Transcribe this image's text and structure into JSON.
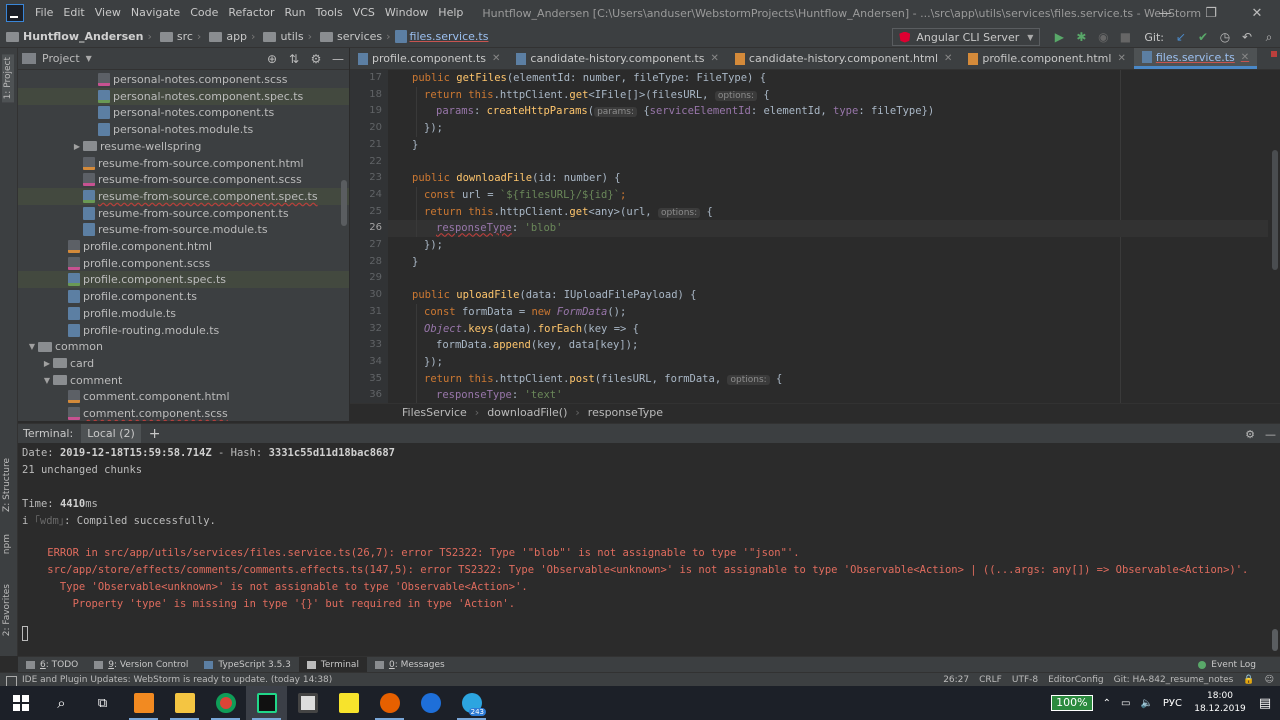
{
  "menubar": {
    "items": [
      "File",
      "Edit",
      "View",
      "Navigate",
      "Code",
      "Refactor",
      "Run",
      "Tools",
      "VCS",
      "Window",
      "Help"
    ],
    "title": "Huntflow_Andersen [C:\\Users\\anduser\\WebstormProjects\\Huntflow_Andersen] - ...\\src\\app\\utils\\services\\files.service.ts - WebStorm"
  },
  "navbar": {
    "crumbs": [
      "Huntflow_Andersen",
      "src",
      "app",
      "utils",
      "services",
      "files.service.ts"
    ],
    "run_config": "Angular CLI Server",
    "git_label": "Git:"
  },
  "stripe": {
    "project": "1: Project",
    "structure": "Z: Structure",
    "npm": "npm",
    "favorites": "2: Favorites"
  },
  "project": {
    "header": "Project",
    "tree": [
      {
        "label": "personal-notes.component.scss",
        "type": "scss",
        "indent": 4
      },
      {
        "label": "personal-notes.component.spec.ts",
        "type": "spec",
        "indent": 4
      },
      {
        "label": "personal-notes.component.ts",
        "type": "ts",
        "indent": 4
      },
      {
        "label": "personal-notes.module.ts",
        "type": "ts",
        "indent": 4
      },
      {
        "label": "resume-wellspring",
        "type": "folder",
        "indent": 3,
        "arrow": "▶"
      },
      {
        "label": "resume-from-source.component.html",
        "type": "html",
        "indent": 3
      },
      {
        "label": "resume-from-source.component.scss",
        "type": "scss",
        "indent": 3
      },
      {
        "label": "resume-from-source.component.spec.ts",
        "type": "spec",
        "indent": 3
      },
      {
        "label": "resume-from-source.component.ts",
        "type": "ts",
        "indent": 3
      },
      {
        "label": "resume-from-source.module.ts",
        "type": "ts",
        "indent": 3
      },
      {
        "label": "profile.component.html",
        "type": "html",
        "indent": 2
      },
      {
        "label": "profile.component.scss",
        "type": "scss",
        "indent": 2
      },
      {
        "label": "profile.component.spec.ts",
        "type": "spec",
        "indent": 2
      },
      {
        "label": "profile.component.ts",
        "type": "ts",
        "indent": 2
      },
      {
        "label": "profile.module.ts",
        "type": "ts",
        "indent": 2
      },
      {
        "label": "profile-routing.module.ts",
        "type": "ts",
        "indent": 2
      },
      {
        "label": "common",
        "type": "folder",
        "indent": 0,
        "arrow": "▼"
      },
      {
        "label": "card",
        "type": "folder",
        "indent": 1,
        "arrow": "▶"
      },
      {
        "label": "comment",
        "type": "folder",
        "indent": 1,
        "arrow": "▼"
      },
      {
        "label": "comment.component.html",
        "type": "html",
        "indent": 2
      },
      {
        "label": "comment.component.scss",
        "type": "scss",
        "indent": 2
      }
    ]
  },
  "editor": {
    "tabs": [
      {
        "label": "profile.component.ts",
        "color": "#5c7fa3"
      },
      {
        "label": "candidate-history.component.ts",
        "color": "#5c7fa3"
      },
      {
        "label": "candidate-history.component.html",
        "color": "#d48a3a"
      },
      {
        "label": "profile.component.html",
        "color": "#d48a3a"
      },
      {
        "label": "files.service.ts",
        "color": "#5c7fa3"
      }
    ],
    "line_numbers": [
      "17",
      "18",
      "19",
      "20",
      "21",
      "22",
      "23",
      "24",
      "25",
      "26",
      "27",
      "28",
      "29",
      "30",
      "31",
      "32",
      "33",
      "34",
      "35",
      "36"
    ],
    "current_line": "26",
    "breadcrumbs": [
      "FilesService",
      "downloadFile()",
      "responseType"
    ],
    "hints": {
      "options": "options:",
      "params": "params:"
    },
    "code": {
      "l17a": "public ",
      "l17b": "getFiles",
      "l17c": "(elementId: number, fileType: FileType) {",
      "l18a": "return ",
      "l18b": "this",
      "l18c": ".httpClient.",
      "l18d": "get",
      "l18e": "<IFile[]>(filesURL, ",
      "l18f": "{",
      "l19a": "params",
      "l19b": ": ",
      "l19c": "createHttpParams",
      "l19d": "(",
      "l19e": "{",
      "l19f": "serviceElementId",
      "l19g": ": elementId, ",
      "l19h": "type",
      "l19i": ": fileType})",
      "l20": "});",
      "l21": "}",
      "l23a": "public ",
      "l23b": "downloadFile",
      "l23c": "(id: number) {",
      "l24a": "const ",
      "l24b": "url = ",
      "l24c": "`${filesURL}/${id}`",
      "l24d": ";",
      "l25a": "return ",
      "l25b": "this",
      "l25c": ".httpClient.",
      "l25d": "get",
      "l25e": "<any>(url, ",
      "l25f": "{",
      "l26a": "responseType",
      "l26b": ": ",
      "l26c": "'blob'",
      "l27": "});",
      "l28": "}",
      "l30a": "public ",
      "l30b": "uploadFile",
      "l30c": "(data: IUploadFilePayload) {",
      "l31a": "const ",
      "l31b": "formData = ",
      "l31c": "new ",
      "l31d": "FormData",
      "l31e": "();",
      "l32a": "Object",
      "l32b": ".",
      "l32c": "keys",
      "l32d": "(data).",
      "l32e": "forEach",
      "l32f": "(key => {",
      "l33a": "formData.",
      "l33b": "append",
      "l33c": "(key, data[key]);",
      "l34": "});",
      "l35a": "return ",
      "l35b": "this",
      "l35c": ".httpClient.",
      "l35d": "post",
      "l35e": "(filesURL, formData, ",
      "l35f": "{",
      "l36a": "responseType",
      "l36b": ": ",
      "l36c": "'text'"
    }
  },
  "terminal": {
    "label": "Terminal:",
    "tab": "Local (2)",
    "lines": {
      "date_label": "Date: ",
      "date_value": "2019-12-18T15:59:58.714Z",
      "hash_label": " - Hash: ",
      "hash_value": "3331c55d11d18bac8687",
      "chunks": "21 unchanged chunks",
      "time_label": "Time: ",
      "time_value": "4410",
      "time_unit": "ms",
      "compiled_prefix": "i ",
      "compiled_wdm": "｢wdm｣",
      "compiled_text": ": Compiled successfully.",
      "err1": "    ERROR in src/app/utils/services/files.service.ts(26,7): error TS2322: Type '\"blob\"' is not assignable to type '\"json\"'.",
      "err2": "    src/app/store/effects/comments/comments.effects.ts(147,5): error TS2322: Type 'Observable<unknown>' is not assignable to type 'Observable<Action> | ((...args: any[]) => Observable<Action>)'.",
      "err3": "      Type 'Observable<unknown>' is not assignable to type 'Observable<Action>'.",
      "err4": "        Property 'type' is missing in type '{}' but required in type 'Action'."
    }
  },
  "bottom_tools": {
    "todo_num": "6",
    "todo": ": TODO",
    "vc_num": "9",
    "vc": ": Version Control",
    "ts": "TypeScript 3.5.3",
    "terminal": "Terminal",
    "msg_num": "0",
    "msg": ": Messages",
    "event_log": "Event Log"
  },
  "status": {
    "message": "IDE and Plugin Updates: WebStorm is ready to update. (today 14:38)",
    "position": "26:27",
    "line_sep": "CRLF",
    "encoding": "UTF-8",
    "editorconfig": "EditorConfig",
    "branch": "Git: HA-842_resume_notes"
  },
  "taskbar": {
    "battery": "100%",
    "lang": "РУС",
    "time": "18:00",
    "date": "18.12.2019",
    "telegram_badge": "243"
  }
}
